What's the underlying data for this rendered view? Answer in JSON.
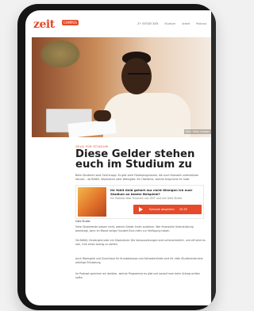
{
  "site": {
    "logo": "zeit",
    "logo_badge": "CAMPUS",
    "nav": [
      "Z+ ENTDECKEN",
      "Studium",
      "Arbeit",
      "Podcast"
    ]
  },
  "hero": {
    "caption": "Foto: Getty Images"
  },
  "article": {
    "kicker": "Geld für Studium",
    "headline": "Diese Gelder stehen euch im Studium zu",
    "paragraphs": [
      "Beim Studieren wird Geld knapp. Es gibt viele Förderprogramme, die euch finanziell unterstützen können – ob BAföG, Stipendium oder Wohngeld. Ein Überblick, welche Ansprüche ihr habt.",
      "Viele Studierende wissen nicht, welche Gelder ihnen zustehen. Wer finanzielle Unterstützung beantragt, kann im Monat einige Hundert Euro mehr zur Verfügung haben.",
      "Ob BAföG, Kindergeld oder ein Stipendium: Die Voraussetzungen sind unterschiedlich, und oft lohnt es sich, früh einen Antrag zu stellen.",
      "Auch Wohngeld und Zuschüsse für Krankenkasse und Semesterticket sind für viele Studierende eine wichtige Entlastung.",
      "Im Podcast sprechen wir darüber, welche Programme es gibt und worauf man beim Antrag achten sollte."
    ]
  },
  "podcast_card": {
    "title": "Ihr fühlt Geld gehört nur nicht Wenigen ich euer Studium an bester Beispiele?",
    "subtitle": "Ein Podcast über Finanzen von ZEIT und von Geld Studio",
    "play_label": "Episode abspielen",
    "duration": "20:35",
    "brand": "Geld Studio"
  },
  "colors": {
    "accent": "#e54b2a",
    "device": "#151515"
  }
}
